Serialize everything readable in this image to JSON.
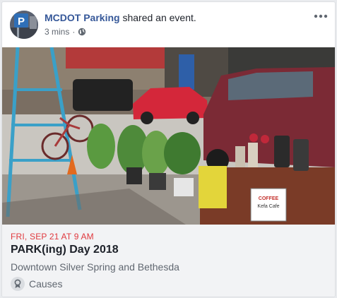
{
  "post": {
    "poster_name": "MCDOT Parking",
    "action_text": " shared an event.",
    "timestamp": "3 mins",
    "separator": " · ",
    "privacy_icon": "globe-icon",
    "more_icon": "more-horizontal-icon"
  },
  "avatar": {
    "letter": "P",
    "colors": {
      "sign": "#2f6fb7",
      "bg": "#5a6170"
    }
  },
  "event": {
    "date": "FRI, SEP 21 AT 9 AM",
    "title": "PARK(ing) Day 2018",
    "location": "Downtown Silver Spring and Bethesda",
    "category": "Causes",
    "category_icon": "ribbon-icon"
  },
  "photo": {
    "sign_line1": "COFFEE",
    "sign_line2": "Kefa Cafe"
  },
  "colors": {
    "link": "#365899",
    "date_red": "#e0393e",
    "event_bg": "#f2f3f5"
  }
}
